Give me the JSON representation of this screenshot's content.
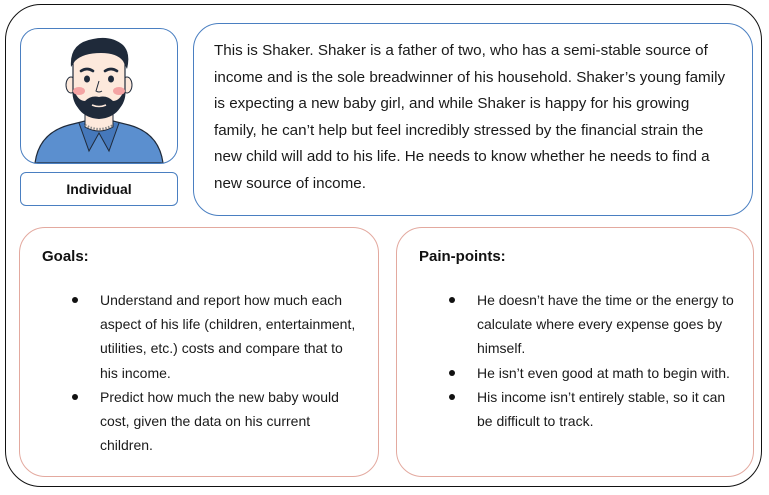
{
  "persona": {
    "role_label": "Individual",
    "bio": "This is Shaker. Shaker is a father of two, who has a semi-stable source of income and is the sole breadwinner of his household. Shaker’s young family is expecting a new baby girl, and while Shaker is happy for his growing family, he can’t help but feel incredibly stressed by the financial strain the new child will add to his life. He needs to know whether he needs to find a new source of income.",
    "avatar_icon": "bearded-man-avatar-icon"
  },
  "goals": {
    "title": "Goals:",
    "items": [
      "Understand and report how much each aspect of his life (children, entertainment, utilities, etc.) costs and compare that to his income.",
      "Predict how much the new baby would cost, given the data on his current children."
    ]
  },
  "pain_points": {
    "title": "Pain-points:",
    "items": [
      "He doesn’t have the time or the energy to calculate where every expense goes by himself.",
      "He isn’t even good at math to begin with.",
      "His income isn’t entirely stable, so it can be difficult to track."
    ]
  },
  "colors": {
    "outer_border": "#111111",
    "blue_border": "#4a7fc1",
    "pink_border": "#e3a99f",
    "shirt_blue": "#5b8fcf",
    "hair": "#1f2a3a",
    "skin": "#fde9dc",
    "cheek": "#f4a3a3"
  }
}
